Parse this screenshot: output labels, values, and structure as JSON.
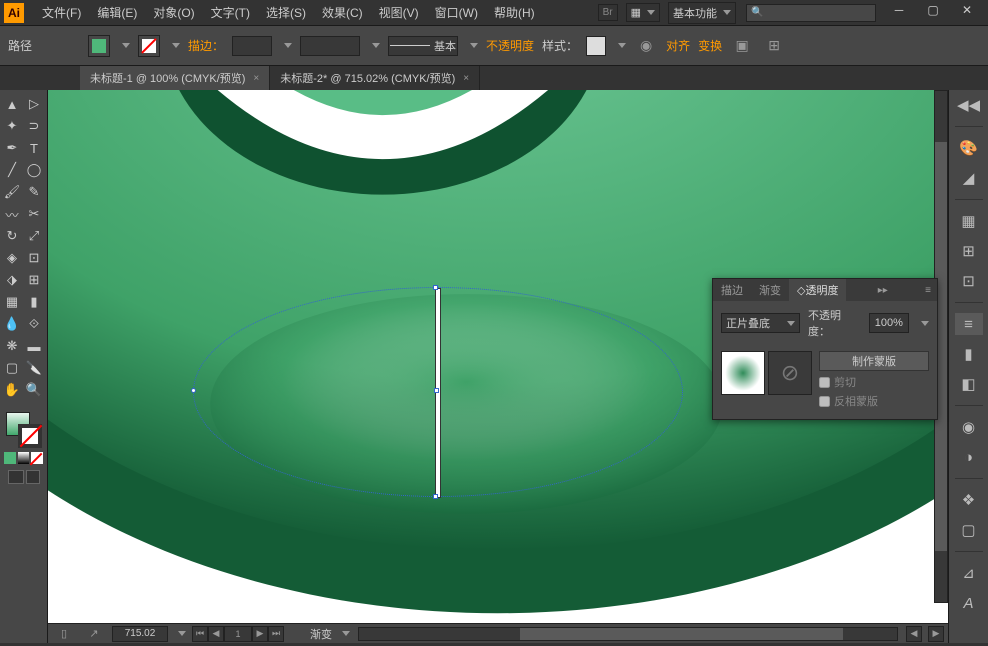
{
  "app_icon_text": "Ai",
  "menu": [
    "文件(F)",
    "编辑(E)",
    "对象(O)",
    "文字(T)",
    "选择(S)",
    "效果(C)",
    "视图(V)",
    "窗口(W)",
    "帮助(H)"
  ],
  "workspace": "基本功能",
  "control": {
    "left_label": "路径",
    "stroke_label": "描边：",
    "stroke_basic": "基本",
    "opacity_label": "不透明度",
    "style_label": "样式：",
    "align_label": "对齐",
    "transform_label": "变换"
  },
  "tabs": [
    {
      "label": "未标题-1 @ 100% (CMYK/预览)",
      "active": false
    },
    {
      "label": "未标题-2* @ 715.02% (CMYK/预览)",
      "active": true
    }
  ],
  "trans_panel": {
    "tab_stroke": "描边",
    "tab_gradient": "渐变",
    "tab_trans": "透明度",
    "blend_mode": "正片叠底",
    "opacity_label": "不透明度：",
    "opacity_value": "100%",
    "make_mask": "制作蒙版",
    "clip": "剪切",
    "invert": "反相蒙版"
  },
  "status": {
    "zoom": "715.02",
    "page": "1",
    "center_text": "渐变"
  },
  "chart_data": null
}
